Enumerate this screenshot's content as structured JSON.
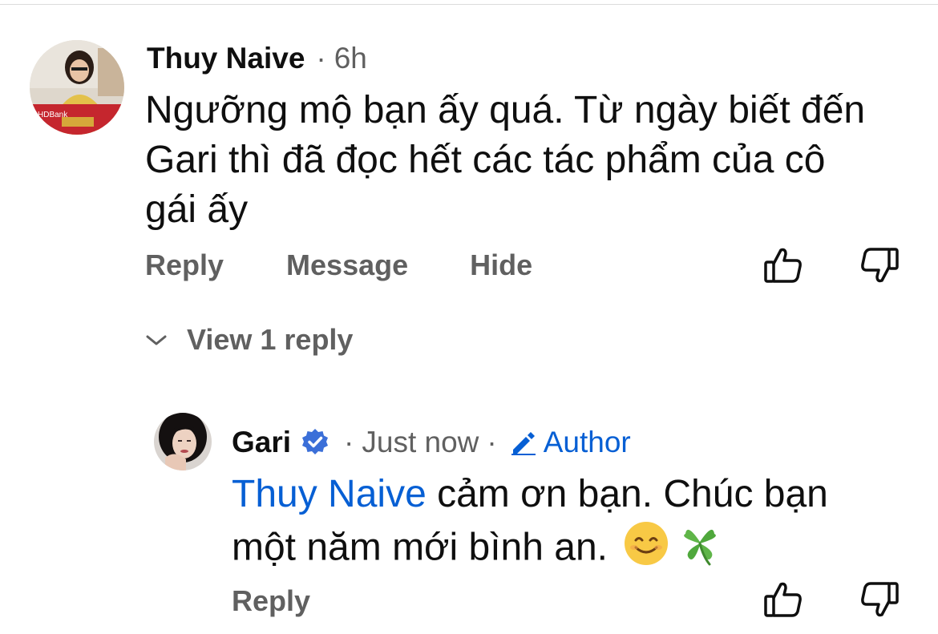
{
  "comment": {
    "author": "Thuy Naive",
    "separator": "·",
    "time": "6h",
    "text_line1": "Ngưỡng mộ bạn ấy quá. Từ ngày biết đến",
    "text_line2": "Gari thì đã đọc hết các tác phẩm của cô",
    "text_line3": "gái ấy",
    "actions": {
      "reply": "Reply",
      "message": "Message",
      "hide": "Hide"
    },
    "view_replies": "View 1 reply",
    "avatar_badge_text": "HDBank"
  },
  "reply": {
    "author": "Gari",
    "separator1": "·",
    "time": "Just now",
    "separator2": "·",
    "author_badge": "Author",
    "mention": "Thuy Naive",
    "text_line1_rest": " cảm ơn bạn. Chúc bạn",
    "text_line2": "một năm mới bình an. ",
    "emojis": [
      "smiling-face-emoji",
      "four-leaf-clover-emoji"
    ],
    "actions": {
      "reply": "Reply"
    }
  },
  "colors": {
    "link_blue": "#065fd4",
    "verified_blue": "#3b6fd8",
    "meta_gray": "#606060",
    "text": "#0f0f0f"
  },
  "icons": [
    "thumbs-up-icon",
    "thumbs-down-icon",
    "chevron-down-icon",
    "verified-check-icon",
    "pencil-icon"
  ]
}
